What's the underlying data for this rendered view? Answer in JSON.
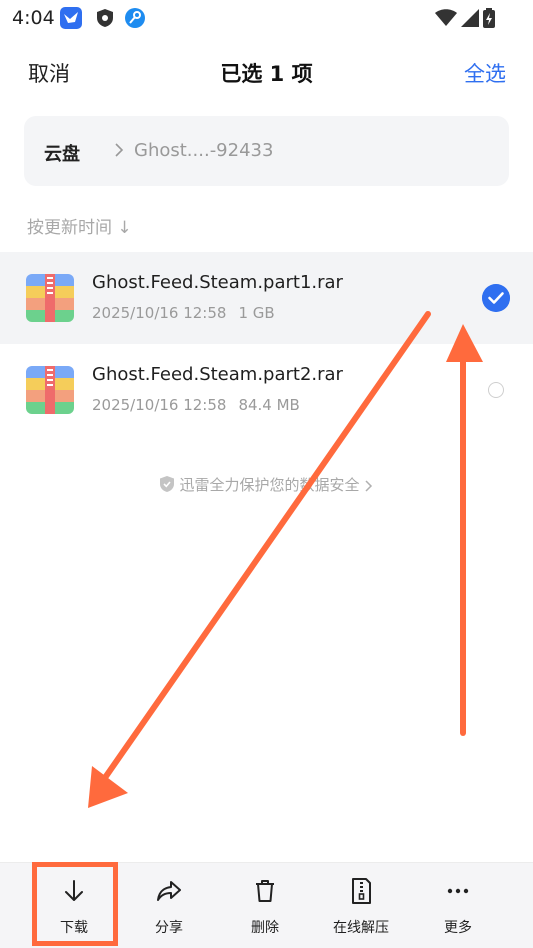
{
  "status_bar": {
    "time": "4:04"
  },
  "header": {
    "cancel": "取消",
    "title": "已选 1 项",
    "select_all": "全选"
  },
  "breadcrumb": {
    "root": "云盘",
    "current": "Ghost....-92433"
  },
  "sort": {
    "label": "按更新时间 ↓"
  },
  "files": [
    {
      "name": "Ghost.Feed.Steam.part1.rar",
      "date": "2025/10/16 12:58",
      "size": "1 GB",
      "selected": true
    },
    {
      "name": "Ghost.Feed.Steam.part2.rar",
      "date": "2025/10/16 12:58",
      "size": "84.4 MB",
      "selected": false
    }
  ],
  "security_note": "迅雷全力保护您的数据安全",
  "toolbar": {
    "download": "下载",
    "share": "分享",
    "delete": "删除",
    "extract_online": "在线解压",
    "more": "更多"
  },
  "colors": {
    "accent": "#2f6ff0",
    "annotation": "#ff6a3d"
  }
}
